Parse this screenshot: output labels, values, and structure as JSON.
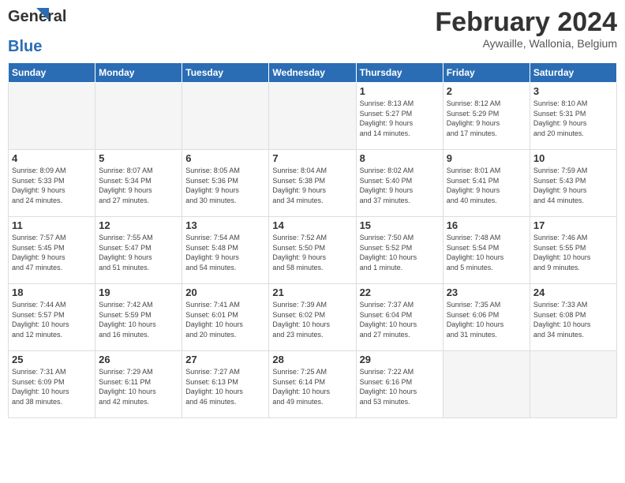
{
  "logo": {
    "general": "General",
    "blue": "Blue"
  },
  "header": {
    "month": "February 2024",
    "location": "Aywaille, Wallonia, Belgium"
  },
  "weekdays": [
    "Sunday",
    "Monday",
    "Tuesday",
    "Wednesday",
    "Thursday",
    "Friday",
    "Saturday"
  ],
  "weeks": [
    [
      {
        "day": "",
        "info": ""
      },
      {
        "day": "",
        "info": ""
      },
      {
        "day": "",
        "info": ""
      },
      {
        "day": "",
        "info": ""
      },
      {
        "day": "1",
        "info": "Sunrise: 8:13 AM\nSunset: 5:27 PM\nDaylight: 9 hours\nand 14 minutes."
      },
      {
        "day": "2",
        "info": "Sunrise: 8:12 AM\nSunset: 5:29 PM\nDaylight: 9 hours\nand 17 minutes."
      },
      {
        "day": "3",
        "info": "Sunrise: 8:10 AM\nSunset: 5:31 PM\nDaylight: 9 hours\nand 20 minutes."
      }
    ],
    [
      {
        "day": "4",
        "info": "Sunrise: 8:09 AM\nSunset: 5:33 PM\nDaylight: 9 hours\nand 24 minutes."
      },
      {
        "day": "5",
        "info": "Sunrise: 8:07 AM\nSunset: 5:34 PM\nDaylight: 9 hours\nand 27 minutes."
      },
      {
        "day": "6",
        "info": "Sunrise: 8:05 AM\nSunset: 5:36 PM\nDaylight: 9 hours\nand 30 minutes."
      },
      {
        "day": "7",
        "info": "Sunrise: 8:04 AM\nSunset: 5:38 PM\nDaylight: 9 hours\nand 34 minutes."
      },
      {
        "day": "8",
        "info": "Sunrise: 8:02 AM\nSunset: 5:40 PM\nDaylight: 9 hours\nand 37 minutes."
      },
      {
        "day": "9",
        "info": "Sunrise: 8:01 AM\nSunset: 5:41 PM\nDaylight: 9 hours\nand 40 minutes."
      },
      {
        "day": "10",
        "info": "Sunrise: 7:59 AM\nSunset: 5:43 PM\nDaylight: 9 hours\nand 44 minutes."
      }
    ],
    [
      {
        "day": "11",
        "info": "Sunrise: 7:57 AM\nSunset: 5:45 PM\nDaylight: 9 hours\nand 47 minutes."
      },
      {
        "day": "12",
        "info": "Sunrise: 7:55 AM\nSunset: 5:47 PM\nDaylight: 9 hours\nand 51 minutes."
      },
      {
        "day": "13",
        "info": "Sunrise: 7:54 AM\nSunset: 5:48 PM\nDaylight: 9 hours\nand 54 minutes."
      },
      {
        "day": "14",
        "info": "Sunrise: 7:52 AM\nSunset: 5:50 PM\nDaylight: 9 hours\nand 58 minutes."
      },
      {
        "day": "15",
        "info": "Sunrise: 7:50 AM\nSunset: 5:52 PM\nDaylight: 10 hours\nand 1 minute."
      },
      {
        "day": "16",
        "info": "Sunrise: 7:48 AM\nSunset: 5:54 PM\nDaylight: 10 hours\nand 5 minutes."
      },
      {
        "day": "17",
        "info": "Sunrise: 7:46 AM\nSunset: 5:55 PM\nDaylight: 10 hours\nand 9 minutes."
      }
    ],
    [
      {
        "day": "18",
        "info": "Sunrise: 7:44 AM\nSunset: 5:57 PM\nDaylight: 10 hours\nand 12 minutes."
      },
      {
        "day": "19",
        "info": "Sunrise: 7:42 AM\nSunset: 5:59 PM\nDaylight: 10 hours\nand 16 minutes."
      },
      {
        "day": "20",
        "info": "Sunrise: 7:41 AM\nSunset: 6:01 PM\nDaylight: 10 hours\nand 20 minutes."
      },
      {
        "day": "21",
        "info": "Sunrise: 7:39 AM\nSunset: 6:02 PM\nDaylight: 10 hours\nand 23 minutes."
      },
      {
        "day": "22",
        "info": "Sunrise: 7:37 AM\nSunset: 6:04 PM\nDaylight: 10 hours\nand 27 minutes."
      },
      {
        "day": "23",
        "info": "Sunrise: 7:35 AM\nSunset: 6:06 PM\nDaylight: 10 hours\nand 31 minutes."
      },
      {
        "day": "24",
        "info": "Sunrise: 7:33 AM\nSunset: 6:08 PM\nDaylight: 10 hours\nand 34 minutes."
      }
    ],
    [
      {
        "day": "25",
        "info": "Sunrise: 7:31 AM\nSunset: 6:09 PM\nDaylight: 10 hours\nand 38 minutes."
      },
      {
        "day": "26",
        "info": "Sunrise: 7:29 AM\nSunset: 6:11 PM\nDaylight: 10 hours\nand 42 minutes."
      },
      {
        "day": "27",
        "info": "Sunrise: 7:27 AM\nSunset: 6:13 PM\nDaylight: 10 hours\nand 46 minutes."
      },
      {
        "day": "28",
        "info": "Sunrise: 7:25 AM\nSunset: 6:14 PM\nDaylight: 10 hours\nand 49 minutes."
      },
      {
        "day": "29",
        "info": "Sunrise: 7:22 AM\nSunset: 6:16 PM\nDaylight: 10 hours\nand 53 minutes."
      },
      {
        "day": "",
        "info": ""
      },
      {
        "day": "",
        "info": ""
      }
    ]
  ]
}
